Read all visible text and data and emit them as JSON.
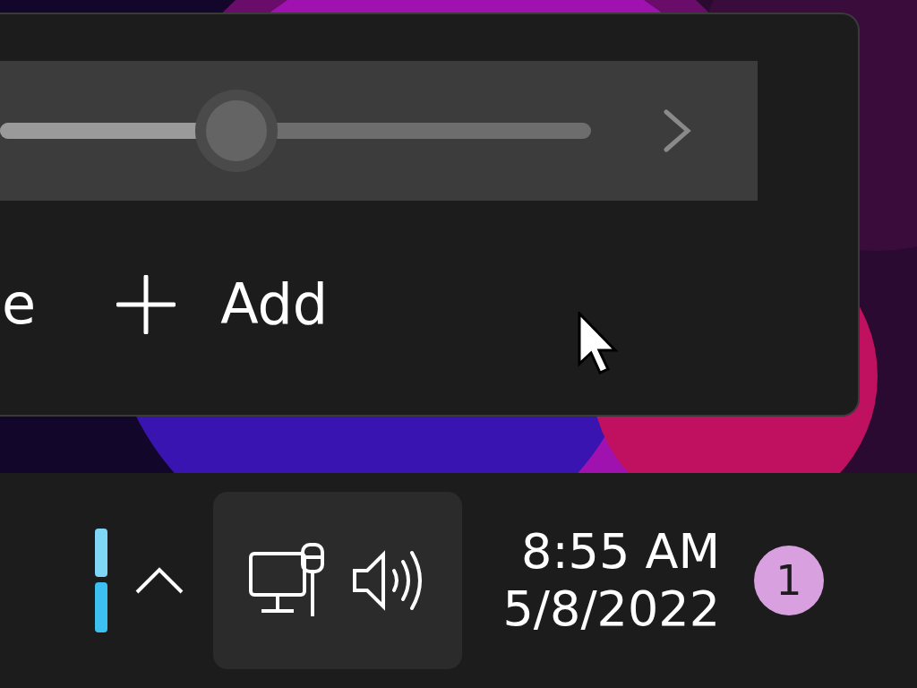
{
  "quick_settings": {
    "volume_slider": {
      "level": 0.4
    },
    "footer": {
      "cut_label": "e",
      "add_button": "Add"
    }
  },
  "taskbar": {
    "clock": {
      "time": "8:55 AM",
      "date": "5/8/2022"
    },
    "notification_badge": "1"
  }
}
